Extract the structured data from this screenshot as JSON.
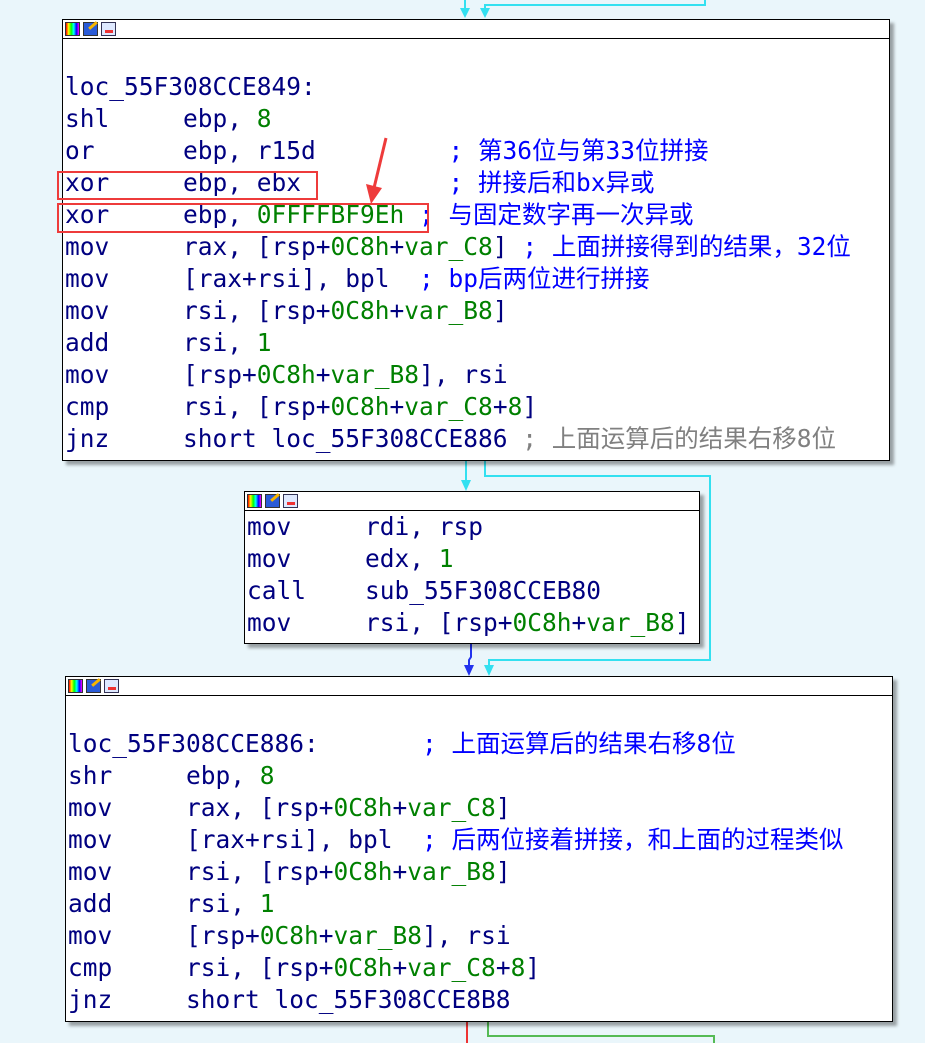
{
  "colors": {
    "background": "#eaf6fb",
    "instruction": "#000080",
    "number": "#008000",
    "comment": "#0000ff",
    "repeat_comment": "#808080",
    "edge_normal": "#33e0f0",
    "edge_true": "#55bb55",
    "edge_false": "#ee3333",
    "highlight": "#ee3b3b"
  },
  "header_icons": [
    "color-palette-icon",
    "edit-pencil-icon",
    "graph-overview-icon"
  ],
  "blocks": [
    {
      "lines": [
        [],
        [
          [
            "loc_55F308CCE849:",
            ""
          ]
        ],
        [
          [
            "shl     ebp, ",
            ""
          ],
          [
            "8",
            "g"
          ]
        ],
        [
          [
            "or      ebp, r15d         ",
            ""
          ],
          [
            "; 第36位与第33位拼接",
            "c"
          ]
        ],
        [
          [
            "xor     ebp, ebx          ",
            ""
          ],
          [
            "; 拼接后和bx异或",
            "c"
          ]
        ],
        [
          [
            "xor     ebp, ",
            ""
          ],
          [
            "0FFFFBF9Eh",
            "g"
          ],
          [
            " ",
            ""
          ],
          [
            "; 与固定数字再一次异或",
            "c"
          ]
        ],
        [
          [
            "mov     rax, [rsp+",
            ""
          ],
          [
            "0C8h",
            "g"
          ],
          [
            "+",
            ""
          ],
          [
            "var_C8",
            "g"
          ],
          [
            "] ",
            ""
          ],
          [
            "; 上面拼接得到的结果，32位",
            "c"
          ]
        ],
        [
          [
            "mov     [rax+rsi], bpl  ",
            ""
          ],
          [
            "; bp后两位进行拼接",
            "c"
          ]
        ],
        [
          [
            "mov     rsi, [rsp+",
            ""
          ],
          [
            "0C8h",
            "g"
          ],
          [
            "+",
            ""
          ],
          [
            "var_B8",
            "g"
          ],
          [
            "]",
            ""
          ]
        ],
        [
          [
            "add     rsi, ",
            ""
          ],
          [
            "1",
            "g"
          ]
        ],
        [
          [
            "mov     [rsp+",
            ""
          ],
          [
            "0C8h",
            "g"
          ],
          [
            "+",
            ""
          ],
          [
            "var_B8",
            "g"
          ],
          [
            "], rsi",
            ""
          ]
        ],
        [
          [
            "cmp     rsi, [rsp+",
            ""
          ],
          [
            "0C8h",
            "g"
          ],
          [
            "+",
            ""
          ],
          [
            "var_C8",
            "g"
          ],
          [
            "+",
            ""
          ],
          [
            "8",
            "g"
          ],
          [
            "]",
            ""
          ]
        ],
        [
          [
            "jnz     short loc_55F308CCE886 ",
            ""
          ],
          [
            "; 上面运算后的结果右移8位",
            "gray"
          ]
        ]
      ]
    },
    {
      "lines": [
        [
          [
            "mov     rdi, rsp",
            ""
          ]
        ],
        [
          [
            "mov     edx, ",
            ""
          ],
          [
            "1",
            "g"
          ]
        ],
        [
          [
            "call    sub_55F308CCEB80",
            ""
          ]
        ],
        [
          [
            "mov     rsi, [rsp+",
            ""
          ],
          [
            "0C8h",
            "g"
          ],
          [
            "+",
            ""
          ],
          [
            "var_B8",
            "g"
          ],
          [
            "]",
            ""
          ]
        ]
      ]
    },
    {
      "lines": [
        [],
        [
          [
            "loc_55F308CCE886:       ",
            ""
          ],
          [
            "; 上面运算后的结果右移8位",
            "c"
          ]
        ],
        [
          [
            "shr     ebp, ",
            ""
          ],
          [
            "8",
            "g"
          ]
        ],
        [
          [
            "mov     rax, [rsp+",
            ""
          ],
          [
            "0C8h",
            "g"
          ],
          [
            "+",
            ""
          ],
          [
            "var_C8",
            "g"
          ],
          [
            "]",
            ""
          ]
        ],
        [
          [
            "mov     [rax+rsi], bpl  ",
            ""
          ],
          [
            "; 后两位接着拼接，和上面的过程类似",
            "c"
          ]
        ],
        [
          [
            "mov     rsi, [rsp+",
            ""
          ],
          [
            "0C8h",
            "g"
          ],
          [
            "+",
            ""
          ],
          [
            "var_B8",
            "g"
          ],
          [
            "]",
            ""
          ]
        ],
        [
          [
            "add     rsi, ",
            ""
          ],
          [
            "1",
            "g"
          ]
        ],
        [
          [
            "mov     [rsp+",
            ""
          ],
          [
            "0C8h",
            "g"
          ],
          [
            "+",
            ""
          ],
          [
            "var_B8",
            "g"
          ],
          [
            "], rsi",
            ""
          ]
        ],
        [
          [
            "cmp     rsi, [rsp+",
            ""
          ],
          [
            "0C8h",
            "g"
          ],
          [
            "+",
            ""
          ],
          [
            "var_C8",
            "g"
          ],
          [
            "+",
            ""
          ],
          [
            "8",
            "g"
          ],
          [
            "]",
            ""
          ]
        ],
        [
          [
            "jnz     short loc_55F308CCE8B8",
            ""
          ]
        ]
      ]
    }
  ]
}
